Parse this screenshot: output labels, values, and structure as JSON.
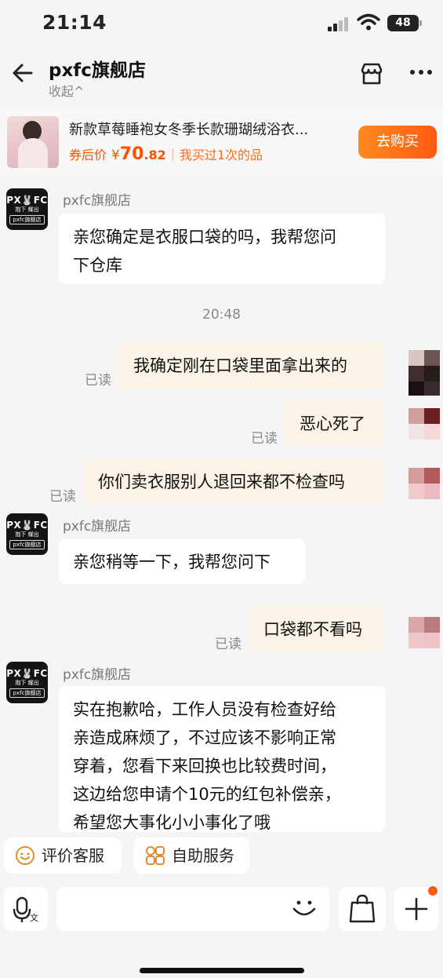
{
  "status_bar": {
    "time": "21:14",
    "battery": "48"
  },
  "header": {
    "shop_name": "pxfc旗舰店",
    "collapse_label": "收起^"
  },
  "product": {
    "title": "新款草莓睡袍女冬季长款珊瑚绒浴衣...",
    "price_label": "券后价",
    "currency": "¥",
    "price_int": "70",
    "price_dec": ".82",
    "bought_text": "我买过1次的品",
    "buy_button": "去购买"
  },
  "avatar": {
    "line1": "PX🐰FC",
    "line2": "抱下 耀出",
    "line3": "pxfc旗舰店"
  },
  "messages": [
    {
      "from": "shop",
      "sender": "pxfc旗舰店",
      "text": "亲您确定是衣服口袋的吗，我帮您问\n下仓库"
    },
    {
      "timestamp": "20:48"
    },
    {
      "from": "me",
      "text": "我确定刚在口袋里面拿出来的",
      "status": "已读"
    },
    {
      "from": "me",
      "text": "恶心死了",
      "status": "已读"
    },
    {
      "from": "me",
      "text": "你们卖衣服别人退回来都不检查吗",
      "status": "已读"
    },
    {
      "from": "shop",
      "sender": "pxfc旗舰店",
      "text": "亲您稍等一下，我帮您问下"
    },
    {
      "from": "me",
      "text": "口袋都不看吗",
      "status": "已读"
    },
    {
      "from": "shop",
      "sender": "pxfc旗舰店",
      "text": "实在抱歉哈，工作人员没有检查好给\n亲造成麻烦了，不过应该不影响正常\n穿着，您看下来回换也比较费时间，\n这边给您申请个10元的红包补偿亲，\n希望您大事化小小事化了哦"
    }
  ],
  "quick_actions": {
    "rate": "评价客服",
    "self_service": "自助服务"
  },
  "input": {
    "placeholder": "",
    "voice_label": "文"
  },
  "colors": {
    "accent": "#ff5a12",
    "my_bubble": "#fbf3e6",
    "shop_bubble": "#ffffff"
  },
  "icons": [
    "back-arrow-icon",
    "store-icon",
    "more-icon",
    "smile-icon",
    "grid-icon",
    "microphone-icon",
    "emoji-icon",
    "shopping-bag-icon",
    "plus-icon"
  ]
}
